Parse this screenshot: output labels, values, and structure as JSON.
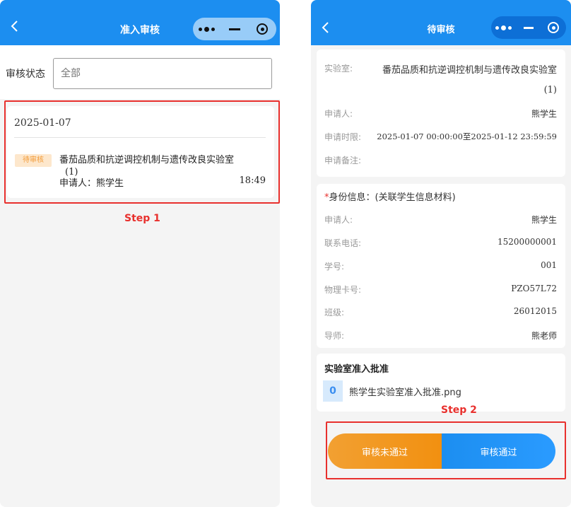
{
  "left": {
    "title": "准入审核",
    "filter": {
      "label": "审核状态",
      "placeholder": "全部"
    },
    "card": {
      "date": "2025-01-07",
      "badge": "待审核",
      "lab": "番茄品质和抗逆调控机制与遗传改良实验室",
      "lab_suffix": "(1)",
      "applicant": "申请人：熊学生",
      "time": "18:49"
    },
    "step_label": "Step 1"
  },
  "right": {
    "title": "待审核",
    "info": {
      "lab_label": "实验室:",
      "lab_value": "番茄品质和抗逆调控机制与遗传改良实验室",
      "lab_suffix": "(1)",
      "applicant_label": "申请人:",
      "applicant_value": "熊学生",
      "period_label": "申请时限:",
      "period_value": "2025-01-07 00:00:00至2025-01-12 23:59:59",
      "remark_label": "申请备注:"
    },
    "identity": {
      "star": "*",
      "title": "身份信息：(关联学生信息材料)",
      "rows": [
        {
          "label": "申请人:",
          "value": "熊学生"
        },
        {
          "label": "联系电话:",
          "value": "15200000001"
        },
        {
          "label": "学号:",
          "value": "001"
        },
        {
          "label": "物理卡号:",
          "value": "PZO57L72"
        },
        {
          "label": "班级:",
          "value": "26012015"
        },
        {
          "label": "导师:",
          "value": "熊老师"
        }
      ]
    },
    "approval": {
      "title": "实验室准入批准",
      "file_icon_glyph": "0",
      "file_name": "熊学生实验室准入批准.png"
    },
    "buttons": {
      "reject": "审核未通过",
      "approve": "审核通过"
    },
    "step_label": "Step 2"
  },
  "colors": {
    "brand_blue": "#1c8ef0",
    "highlight_red": "#e8302d",
    "pending_orange": "#f29b38"
  }
}
